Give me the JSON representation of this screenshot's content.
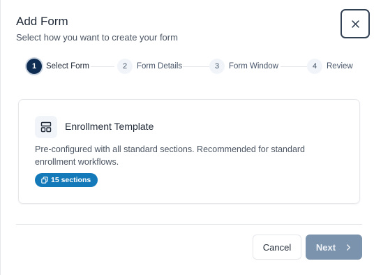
{
  "dialog": {
    "title": "Add Form",
    "subtitle": "Select how you want to create your form",
    "close_icon": "close-icon"
  },
  "stepper": {
    "steps": [
      {
        "number": "1",
        "label": "Select Form",
        "active": true
      },
      {
        "number": "2",
        "label": "Form Details",
        "active": false
      },
      {
        "number": "3",
        "label": "Form Window",
        "active": false
      },
      {
        "number": "4",
        "label": "Review",
        "active": false
      }
    ]
  },
  "template_card": {
    "icon": "template-layout-icon",
    "title": "Enrollment Template",
    "description": "Pre-configured with all standard sections. Recommended for standard enrollment workflows.",
    "badge_icon": "sections-copy-icon",
    "badge_label": "15 sections"
  },
  "footer": {
    "cancel_label": "Cancel",
    "next_label": "Next",
    "next_icon": "chevron-right-icon"
  },
  "colors": {
    "active_step": "#0f2d52",
    "badge": "#1479b8",
    "next_button_disabled": "#7c93ad"
  }
}
